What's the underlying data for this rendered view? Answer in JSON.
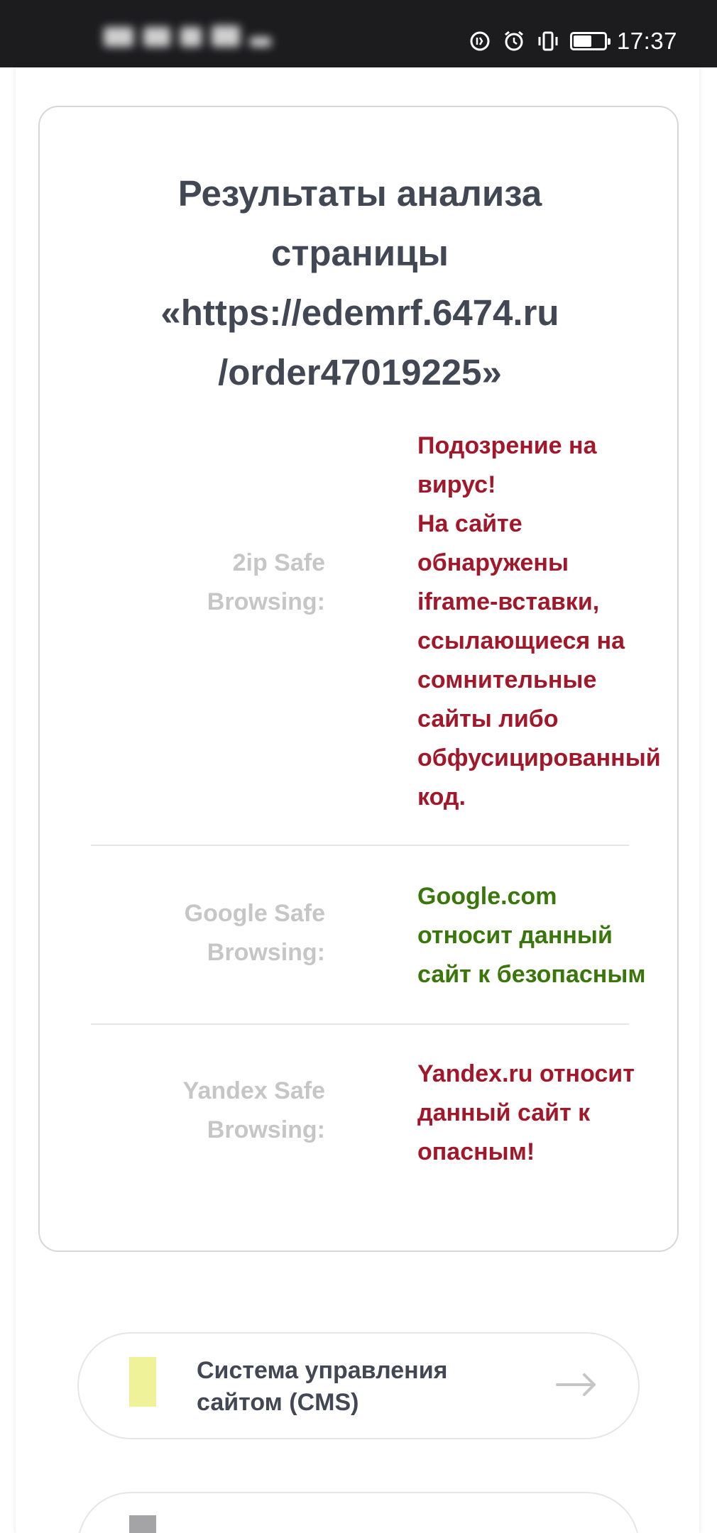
{
  "status_bar": {
    "time": "17:37",
    "battery_level": 0.55,
    "icons": [
      "data-saver-icon",
      "alarm-icon",
      "vibrate-icon",
      "battery-icon"
    ]
  },
  "result": {
    "title_line1": "Результаты анализа",
    "title_line2": "страницы",
    "title_line3": "«https://edemrf.6474.ru",
    "title_line4": "/order47019225»",
    "rows": [
      {
        "label_line1": "2ip Safe",
        "label_line2": "Browsing:",
        "status": "danger",
        "value_lines": [
          "Подозрение на",
          "вирус!",
          "На сайте",
          "обнаружены",
          "iframe-вставки,",
          "ссылающиеся на",
          "сомнительные",
          "сайты либо",
          "обфусицированный",
          "код."
        ]
      },
      {
        "label_line1": "Google Safe",
        "label_line2": "Browsing:",
        "status": "safe",
        "value_lines": [
          "Google.com",
          "относит данный",
          "сайт к безопасным"
        ]
      },
      {
        "label_line1": "Yandex Safe",
        "label_line2": "Browsing:",
        "status": "danger",
        "value_lines": [
          "Yandex.ru относит",
          "данный сайт к",
          "опасным!"
        ]
      }
    ]
  },
  "cms": {
    "label_line1": "Система управления",
    "label_line2": "сайтом (CMS)",
    "swatch_color": "#f0f29a",
    "arrow_icon": "arrow-right-icon"
  },
  "next_item": {
    "swatch_color": "#a4a4a6"
  },
  "colors": {
    "danger": "#a2182a",
    "safe": "#3a770b",
    "label": "#c6c6c6",
    "title": "#414753"
  }
}
